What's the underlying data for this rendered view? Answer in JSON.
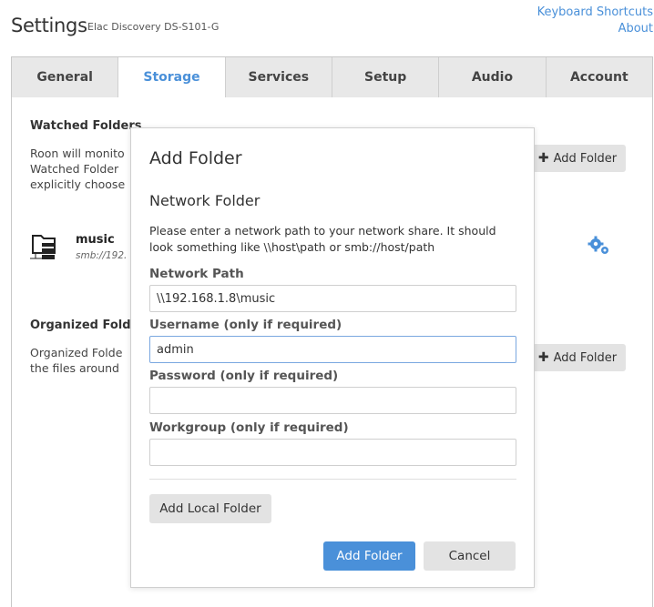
{
  "header": {
    "title": "Settings",
    "device": "Elac Discovery DS-S101-G",
    "links": {
      "shortcuts": "Keyboard Shortcuts",
      "about": "About"
    }
  },
  "tabs": [
    {
      "label": "General"
    },
    {
      "label": "Storage"
    },
    {
      "label": "Services"
    },
    {
      "label": "Setup"
    },
    {
      "label": "Audio"
    },
    {
      "label": "Account"
    }
  ],
  "active_tab": "Storage",
  "watched": {
    "title": "Watched Folders",
    "text_lines": [
      "Roon will monito",
      "Watched Folder",
      "explicitly choose"
    ],
    "add_label": "Add Folder",
    "folder": {
      "name": "music",
      "path": "smb://192."
    }
  },
  "organized": {
    "title": "Organized Folde",
    "text_lines": [
      "Organized Folde",
      "the files around"
    ],
    "add_label": "Add Folder"
  },
  "dialog": {
    "title": "Add Folder",
    "subtitle": "Network Folder",
    "description": "Please enter a network path to your network share. It should look something like \\\\host\\path or smb://host/path",
    "network_path": {
      "label": "Network Path",
      "value": "\\\\192.168.1.8\\music"
    },
    "username": {
      "label": "Username (only if required)",
      "value": "admin"
    },
    "password": {
      "label": "Password (only if required)",
      "value": ""
    },
    "workgroup": {
      "label": "Workgroup (only if required)",
      "value": ""
    },
    "local_button": "Add Local Folder",
    "add_button": "Add Folder",
    "cancel_button": "Cancel"
  },
  "colors": {
    "accent": "#4a90d9",
    "tab_bg": "#e8e8e8",
    "button_bg": "#e3e3e3"
  },
  "icons": {
    "folder": "network-folder-icon",
    "gear": "gear-icon",
    "plus": "plus-icon"
  }
}
